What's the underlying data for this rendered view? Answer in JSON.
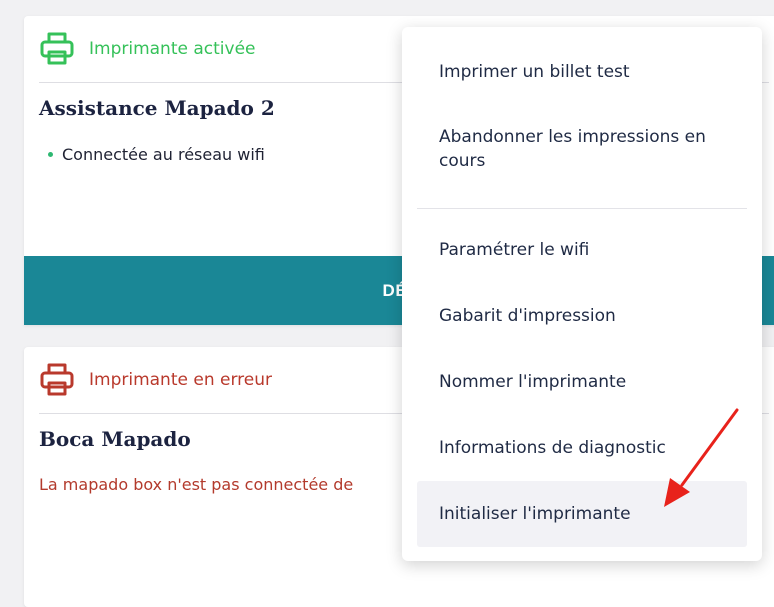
{
  "cards": [
    {
      "status": "Imprimante activée",
      "status_color": "#35c159",
      "icon": "printer-icon",
      "title": "Assistance Mapado 2",
      "bullet": "Connectée au réseau wifi",
      "button_label": "DÉSACT"
    },
    {
      "status": "Imprimante en erreur",
      "status_color": "#b9392c",
      "icon": "printer-icon",
      "title": "Boca Mapado",
      "message": "La mapado box n'est pas connectée de"
    }
  ],
  "menu": {
    "items": [
      {
        "label": "Imprimer un billet test"
      },
      {
        "label": "Abandonner les impressions en cours"
      },
      {
        "label": "Paramétrer le wifi"
      },
      {
        "label": "Gabarit d'impression"
      },
      {
        "label": "Nommer l'imprimante"
      },
      {
        "label": "Informations de diagnostic"
      },
      {
        "label": "Initialiser l'imprimante"
      }
    ]
  },
  "annotation": {
    "arrow_color": "#e8221b",
    "icon": "arrow-icon"
  }
}
